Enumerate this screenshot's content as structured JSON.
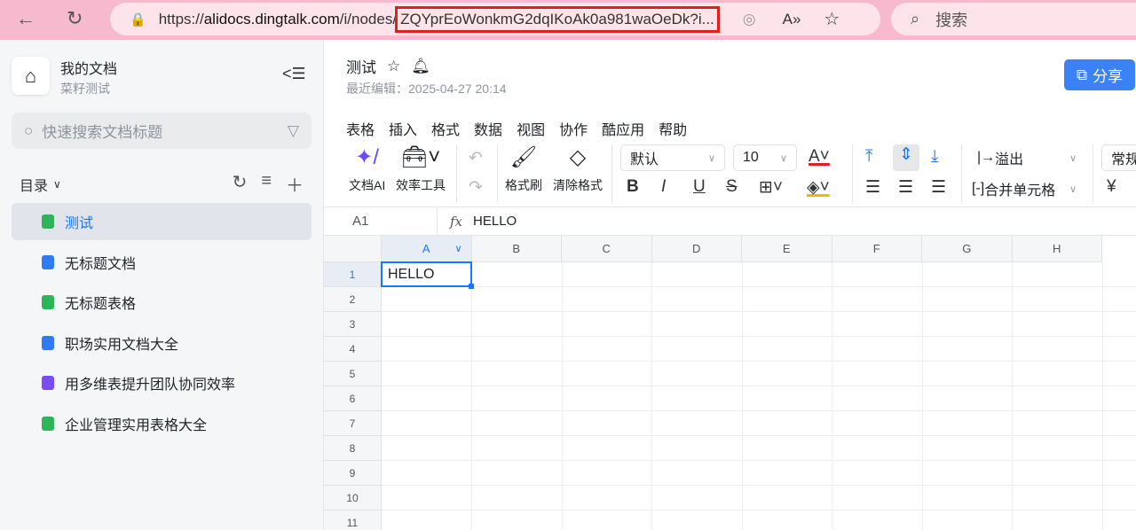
{
  "browser": {
    "url_prefix": "https://",
    "url_host": "alidocs.dingtalk.com",
    "url_path": "/i/nodes/",
    "url_highlight": "ZQYprEoWonkmG2dqIKoAk0a981waOeDk?i...",
    "search_placeholder": "搜索"
  },
  "sidebar": {
    "title": "我的文档",
    "subtitle": "菜籽测试",
    "search_placeholder": "快速搜索文档标题",
    "dir_label": "目录",
    "items": [
      {
        "label": "测试",
        "type": "sheet"
      },
      {
        "label": "无标题文档",
        "type": "doc"
      },
      {
        "label": "无标题表格",
        "type": "sheet"
      },
      {
        "label": "职场实用文档大全",
        "type": "doc"
      },
      {
        "label": "用多维表提升团队协同效率",
        "type": "base"
      },
      {
        "label": "企业管理实用表格大全",
        "type": "sheet"
      }
    ]
  },
  "doc": {
    "title": "测试",
    "last_edited": "最近编辑：2025-04-27 20:14",
    "share": "分享"
  },
  "menu": [
    "表格",
    "插入",
    "格式",
    "数据",
    "视图",
    "协作",
    "酷应用",
    "帮助"
  ],
  "toolbar": {
    "ai": "文档AI",
    "tools": "效率工具",
    "painter": "格式刷",
    "clear": "清除格式",
    "font": "默认",
    "size": "10",
    "overflow": "溢出",
    "merge": "合并单元格",
    "numfmt": "常规",
    "currency": "¥"
  },
  "formula": {
    "cell_ref": "A1",
    "fx": "fx",
    "value": "HELLO"
  },
  "sheet": {
    "columns": [
      "A",
      "B",
      "C",
      "D",
      "E",
      "F",
      "G",
      "H"
    ],
    "rows": [
      "1",
      "2",
      "3",
      "4",
      "5",
      "6",
      "7",
      "8",
      "9",
      "10",
      "11"
    ],
    "A1": "HELLO"
  },
  "colors": {
    "accent": "#1677ff",
    "browser_bar": "#f7b9cd",
    "highlight_box": "#e0201e"
  }
}
